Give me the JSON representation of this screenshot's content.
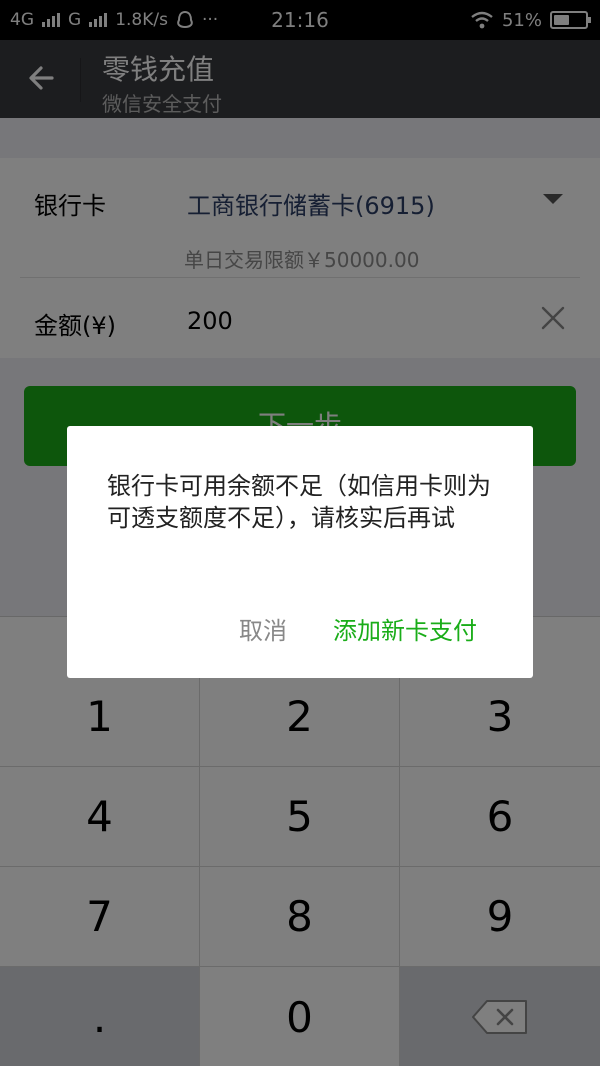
{
  "status_bar": {
    "network_1": "4G",
    "network_2": "G",
    "speed": "1.8K/s",
    "more": "···",
    "time": "21:16",
    "battery": "51%",
    "battery_level": 0.51
  },
  "nav": {
    "title": "零钱充值",
    "subtitle": "微信安全支付"
  },
  "form": {
    "bank_label": "银行卡",
    "bank_value": "工商银行储蓄卡(6915)",
    "limit_text": "单日交易限额￥50000.00",
    "amount_label": "金额(¥)",
    "amount_value": "200"
  },
  "next_button": "下一步",
  "keypad": {
    "keys": [
      "1",
      "2",
      "3",
      "4",
      "5",
      "6",
      "7",
      "8",
      "9",
      ".",
      "0"
    ]
  },
  "dialog": {
    "message": "银行卡可用余额不足（如信用卡则为可透支额度不足），请核实后再试",
    "cancel": "取消",
    "confirm": "添加新卡支付"
  },
  "colors": {
    "accent_green": "#1aad19",
    "nav_bg": "#393a3f",
    "bank_text": "#2c3e66"
  }
}
